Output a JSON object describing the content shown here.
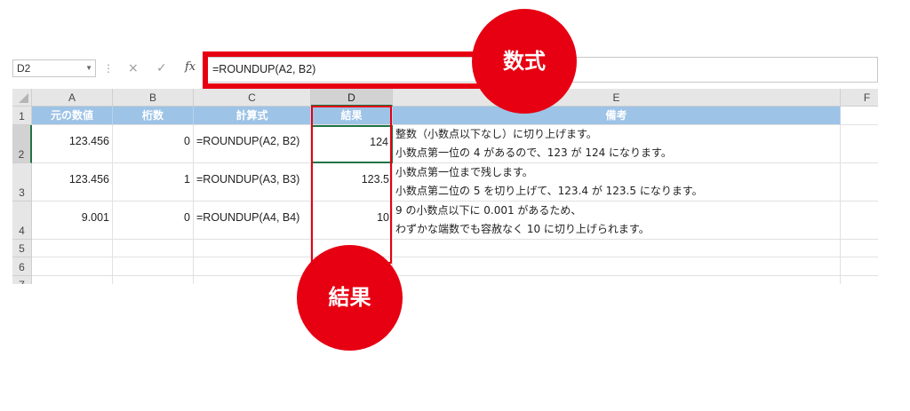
{
  "name_box": {
    "value": "D2"
  },
  "formula_bar": {
    "cancel_glyph": "×",
    "enter_glyph": "✓",
    "fx_label": "fx",
    "dots": "⋮",
    "formula": "=ROUNDUP(A2, B2)"
  },
  "columns": [
    "A",
    "B",
    "C",
    "D",
    "E",
    "F"
  ],
  "rows": [
    "1",
    "2",
    "3",
    "4",
    "5",
    "6",
    "7"
  ],
  "headers": {
    "a": "元の数値",
    "b": "桁数",
    "c": "計算式",
    "d": "結果",
    "e": "備考"
  },
  "data": [
    {
      "a": "123.456",
      "b": "0",
      "c": "=ROUNDUP(A2, B2)",
      "d": "124",
      "e1": "整数（小数点以下なし）に切り上げます。",
      "e2": "小数点第一位の 4 があるので、123 が 124 になります。"
    },
    {
      "a": "123.456",
      "b": "1",
      "c": "=ROUNDUP(A3, B3)",
      "d": "123.5",
      "e1": "小数点第一位まで残します。",
      "e2": "小数点第二位の 5 を切り上げて、123.4 が 123.5 になります。"
    },
    {
      "a": "9.001",
      "b": "0",
      "c": "=ROUNDUP(A4, B4)",
      "d": "10",
      "e1": "9 の小数点以下に 0.001 があるため、",
      "e2": "わずかな端数でも容赦なく 10 に切り上げられます。"
    }
  ],
  "callouts": {
    "formula": "数式",
    "result": "結果"
  },
  "colors": {
    "accent_red": "#e60012",
    "header_blue": "#9dc3e6",
    "excel_green": "#217346"
  }
}
